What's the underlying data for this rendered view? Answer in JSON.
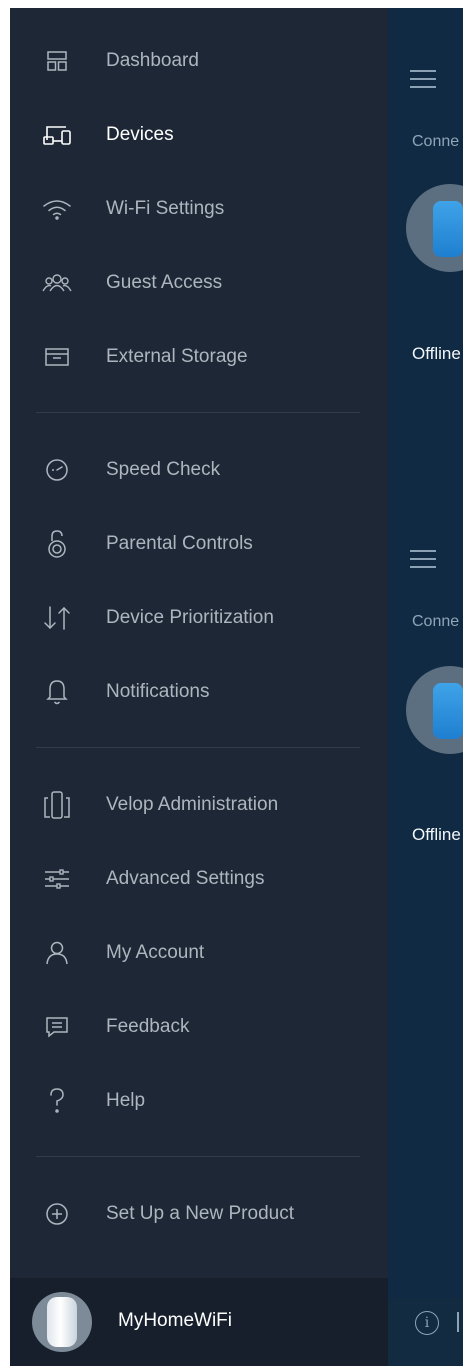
{
  "background_app": {
    "connected_label": "Conne",
    "offline_label": "Offline"
  },
  "drawer": {
    "groups": [
      {
        "items": [
          {
            "label": "Dashboard",
            "icon": "dashboard-icon",
            "active": false
          },
          {
            "label": "Devices",
            "icon": "devices-icon",
            "active": true
          },
          {
            "label": "Wi-Fi Settings",
            "icon": "wifi-icon",
            "active": false
          },
          {
            "label": "Guest Access",
            "icon": "guest-access-icon",
            "active": false
          },
          {
            "label": "External Storage",
            "icon": "external-storage-icon",
            "active": false
          }
        ]
      },
      {
        "items": [
          {
            "label": "Speed Check",
            "icon": "speed-check-icon",
            "active": false
          },
          {
            "label": "Parental Controls",
            "icon": "parental-controls-icon",
            "active": false
          },
          {
            "label": "Device Prioritization",
            "icon": "prioritization-icon",
            "active": false
          },
          {
            "label": "Notifications",
            "icon": "bell-icon",
            "active": false
          }
        ]
      },
      {
        "items": [
          {
            "label": "Velop Administration",
            "icon": "velop-admin-icon",
            "active": false
          },
          {
            "label": "Advanced Settings",
            "icon": "sliders-icon",
            "active": false
          },
          {
            "label": "My Account",
            "icon": "account-icon",
            "active": false
          },
          {
            "label": "Feedback",
            "icon": "feedback-icon",
            "active": false
          },
          {
            "label": "Help",
            "icon": "help-icon",
            "active": false
          }
        ]
      },
      {
        "items": [
          {
            "label": "Set Up a New Product",
            "icon": "add-circle-icon",
            "active": false
          }
        ]
      }
    ],
    "footer": {
      "network_name": "MyHomeWiFi"
    }
  },
  "colors": {
    "drawer_bg": "#1d2735",
    "app_bg": "#0f2a42",
    "node_accent": "#2a8ddc",
    "label_inactive": "#aeb5bf",
    "label_active": "#ffffff"
  }
}
